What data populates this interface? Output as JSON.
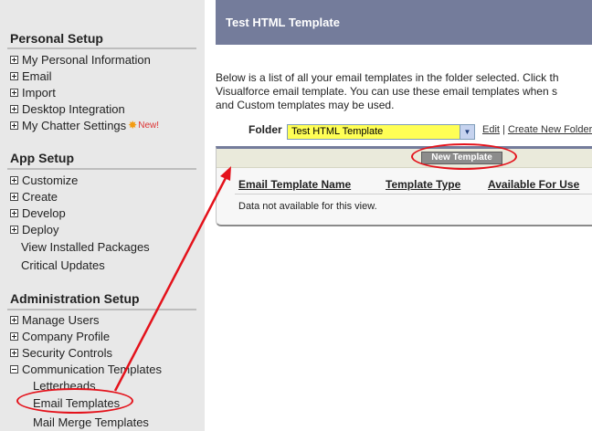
{
  "sidebar": {
    "personal_title": "Personal Setup",
    "personal_items": [
      "My Personal Information",
      "Email",
      "Import",
      "Desktop Integration",
      "My Chatter Settings"
    ],
    "new_badge": "New!",
    "app_title": "App Setup",
    "app_items": [
      "Customize",
      "Create",
      "Develop",
      "Deploy"
    ],
    "app_links": [
      "View Installed Packages",
      "Critical Updates"
    ],
    "admin_title": "Administration Setup",
    "admin_items": [
      "Manage Users",
      "Company Profile",
      "Security Controls",
      "Communication Templates"
    ],
    "comm_items": [
      "Letterheads",
      "Email Templates",
      "Mail Merge Templates"
    ]
  },
  "main": {
    "title": "Test HTML Template",
    "description": [
      "Below is a list of all your email templates in the folder selected. Click th",
      "Visualforce email template. You can use these email templates when s",
      "and Custom templates may be used."
    ],
    "folder_label": "Folder",
    "folder_value": "Test HTML Template",
    "edit_link": "Edit",
    "separator": "|",
    "create_folder_link": "Create New Folder",
    "new_template_button": "New Template",
    "columns": [
      "Email Template Name",
      "Template Type",
      "Available For Use"
    ],
    "empty_message": "Data not available for this view."
  },
  "colors": {
    "header": "#747c9b",
    "sidebar_bg": "#e8e8e8",
    "select_bg": "#ffff55",
    "annotation": "#e4121b"
  }
}
